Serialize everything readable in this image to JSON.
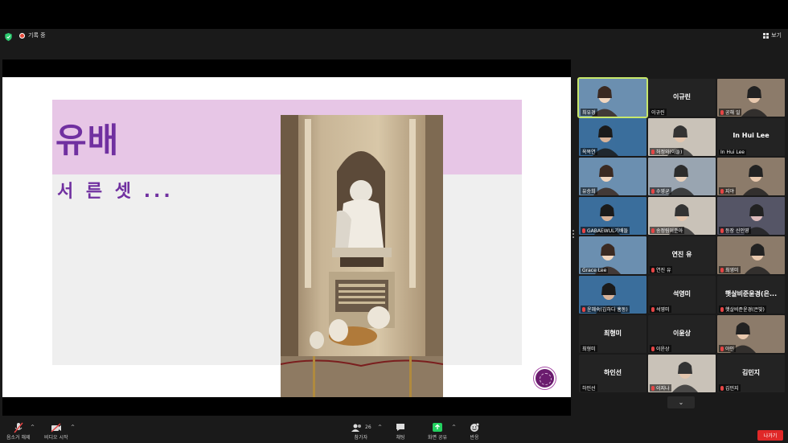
{
  "header": {
    "recording_label": "기록 중",
    "view_label": "보기"
  },
  "slide": {
    "title": "유배",
    "subtitle": "서 른 셋 ...",
    "colors": {
      "accent": "#7030a0",
      "band": "#e7c6e6"
    }
  },
  "participants": [
    {
      "name": "최유경",
      "display": "",
      "video": true,
      "muted": false
    },
    {
      "name": "이규린",
      "display": "이규린",
      "video": false,
      "muted": false
    },
    {
      "name": "공해 일",
      "display": "",
      "video": true,
      "muted": true
    },
    {
      "name": "옥목연",
      "display": "",
      "video": true,
      "muted": false
    },
    {
      "name": "허정와(이들)",
      "display": "",
      "video": true,
      "muted": true
    },
    {
      "name": "In Hui Lee",
      "display": "In Hui Lee",
      "video": false,
      "muted": false
    },
    {
      "name": "유승희",
      "display": "",
      "video": true,
      "muted": false
    },
    {
      "name": "수영균",
      "display": "",
      "video": true,
      "muted": true
    },
    {
      "name": "지야",
      "display": "",
      "video": true,
      "muted": true
    },
    {
      "name": "GABAEWUL기배들",
      "display": "",
      "video": true,
      "muted": true
    },
    {
      "name": "송정림이준아",
      "display": "",
      "video": true,
      "muted": true
    },
    {
      "name": "등장 신인영",
      "display": "",
      "video": true,
      "muted": true
    },
    {
      "name": "Grace Lee",
      "display": "",
      "video": true,
      "muted": false
    },
    {
      "name": "연진 유",
      "display": "연진 유",
      "video": false,
      "muted": true
    },
    {
      "name": "최영미",
      "display": "",
      "video": true,
      "muted": true
    },
    {
      "name": "윤혜숙(김하다 홍동)",
      "display": "",
      "video": true,
      "muted": true
    },
    {
      "name": "석영미",
      "display": "석영미",
      "video": false,
      "muted": true
    },
    {
      "name": "햇살비준윤경(은빛)",
      "display": "햇살비준윤경(은...",
      "video": false,
      "muted": true
    },
    {
      "name": "최형미",
      "display": "최형미",
      "video": false,
      "muted": false
    },
    {
      "name": "이윤상",
      "display": "이윤상",
      "video": false,
      "muted": true
    },
    {
      "name": "야인",
      "display": "",
      "video": true,
      "muted": true
    },
    {
      "name": "하인선",
      "display": "하인선",
      "video": false,
      "muted": false
    },
    {
      "name": "이지나",
      "display": "",
      "video": true,
      "muted": true
    },
    {
      "name": "김민지",
      "display": "김민지",
      "video": false,
      "muted": true
    }
  ],
  "toolbar": {
    "audio_label": "음소거 해제",
    "video_label": "비디오 시작",
    "participants_label": "참가자",
    "participants_count": "26",
    "chat_label": "채팅",
    "share_label": "화면 공유",
    "reactions_label": "반응",
    "leave_label": "나가기"
  }
}
